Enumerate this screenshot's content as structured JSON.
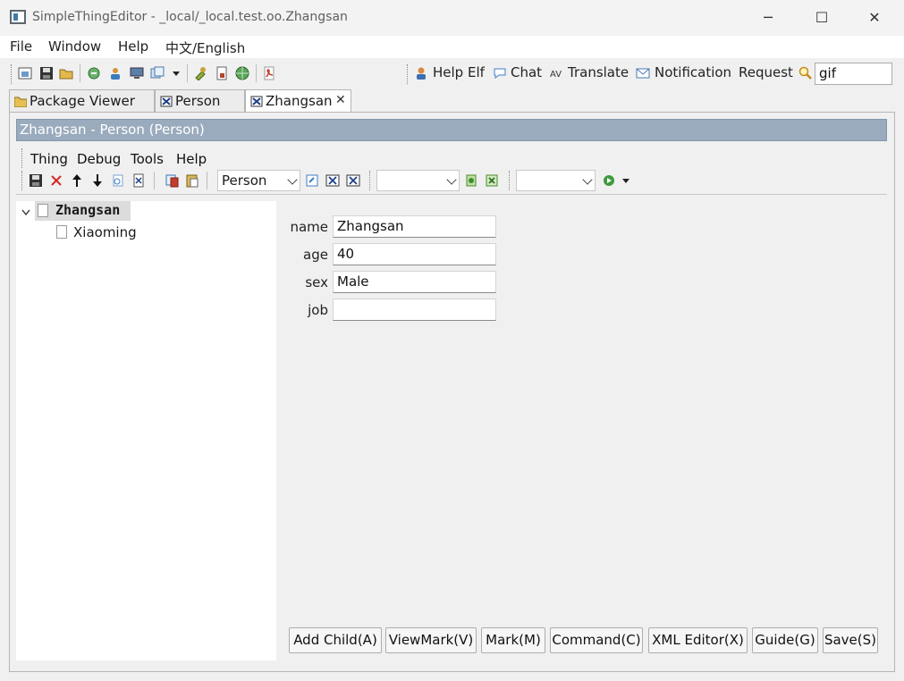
{
  "window": {
    "title": "SimpleThingEditor - _local/_local.test.oo.Zhangsan",
    "minimize": "─",
    "maximize": "☐",
    "close": "✕"
  },
  "menu": [
    "File",
    "Window",
    "Help",
    "中文/English"
  ],
  "toolbar": {
    "help_elf": "Help Elf",
    "chat": "Chat",
    "translate": "Translate",
    "notification": "Notification",
    "request": "Request",
    "search_value": "gif"
  },
  "tabs": [
    {
      "label": "Package Viewer"
    },
    {
      "label": "Person"
    },
    {
      "label": "Zhangsan",
      "active": true
    }
  ],
  "editor": {
    "header": "Zhangsan - Person  (Person)",
    "menu": [
      "Thing",
      "Debug",
      "Tools",
      "Help"
    ],
    "descriptor_select": "Person",
    "select2": "",
    "select3": ""
  },
  "tree": {
    "root": "Zhangsan",
    "children": [
      "Xiaoming"
    ]
  },
  "form": {
    "fields": [
      {
        "label": "name",
        "value": "Zhangsan"
      },
      {
        "label": "age",
        "value": "40"
      },
      {
        "label": "sex",
        "value": "Male"
      },
      {
        "label": "job",
        "value": ""
      }
    ]
  },
  "buttons": {
    "add_child": "Add Child(A)",
    "view_mark": "ViewMark(V)",
    "mark": "Mark(M)",
    "command": "Command(C)",
    "xml_editor": "XML Editor(X)",
    "guide": "Guide(G)",
    "save": "Save(S)"
  },
  "colors": {
    "header_bar": "#9aabbd",
    "accent": "#3d7ea8"
  }
}
